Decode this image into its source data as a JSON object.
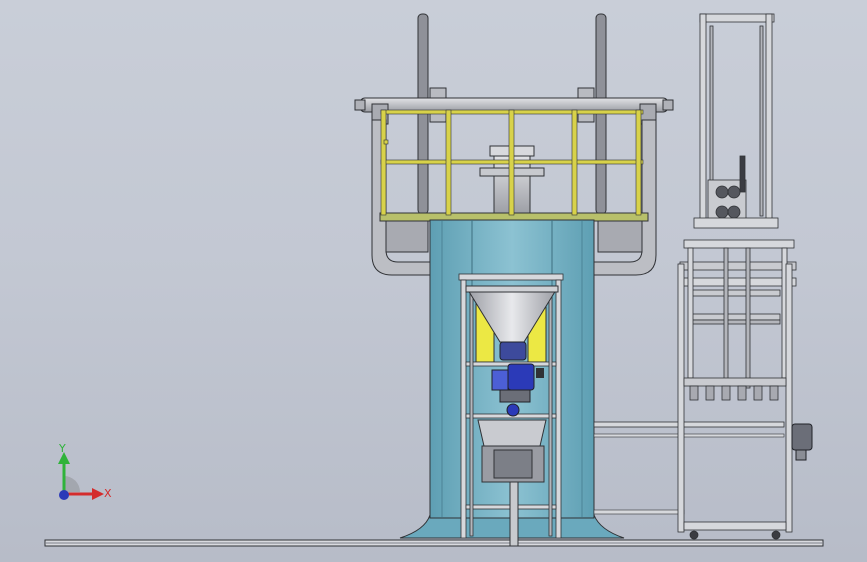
{
  "triad": {
    "y_label": "Y",
    "x_label": "X"
  },
  "colors": {
    "background_top": "#c9ced8",
    "background_bottom": "#b7bcc8",
    "column": "#79b2c4",
    "column_dark": "#4f8fa3",
    "railing": "#d8d24a",
    "frame_gray": "#a3a6ae",
    "frame_light": "#d6d8dc",
    "outline": "#303236",
    "motor_blue": "#2b3ab8",
    "yellow_panel": "#ece844",
    "axis_y": "#2fb33a",
    "axis_x": "#d42c2c",
    "axis_z": "#2b3ab8"
  },
  "components": {
    "reels": "cable-reel-icon",
    "column": "support-column-icon",
    "hopper": "hopper-icon",
    "motor": "gear-motor-icon",
    "tower": "lift-tower-icon",
    "base": "base-rail-icon"
  }
}
